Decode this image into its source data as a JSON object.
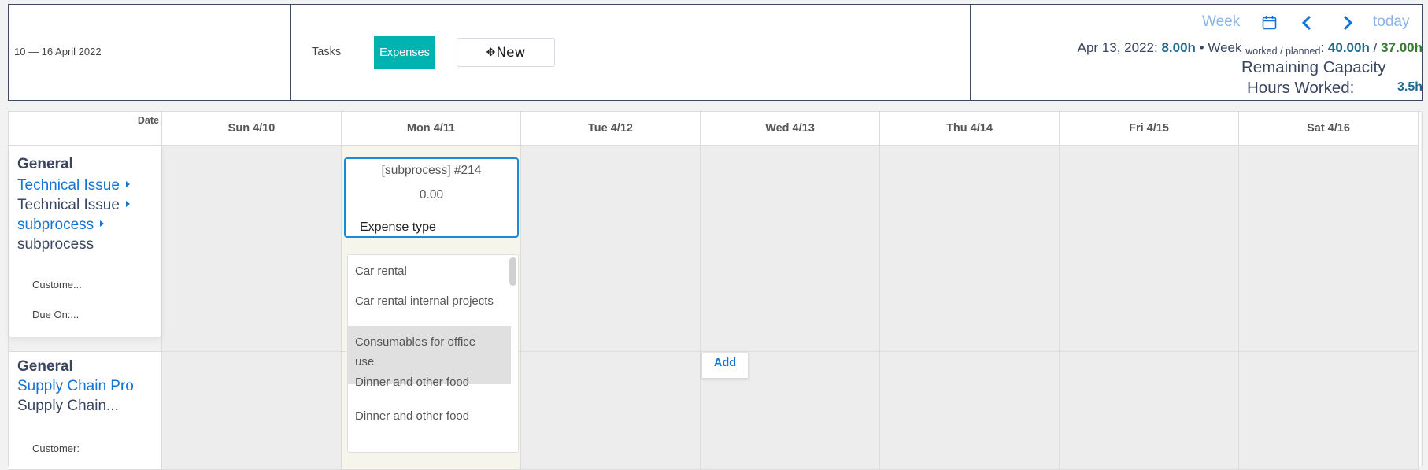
{
  "header": {
    "date_range": "10 — 16 April 2022",
    "tabs": [
      {
        "label": "Tasks",
        "active": false
      },
      {
        "label": "Expenses",
        "active": true
      }
    ],
    "new_button": {
      "icon": "move-icon",
      "label": "New"
    },
    "nav": {
      "view_label": "Week",
      "calendar_icon": "calendar-icon",
      "prev_icon": "chevron-left-icon",
      "next_icon": "chevron-right-icon",
      "today_label": "today"
    },
    "summary": {
      "date": "Apr 13, 2022:",
      "day_hours": "8.00h",
      "separator": "•",
      "week_label": "Week",
      "week_sub": "worked / planned",
      "colon": ":",
      "worked": "40.00h",
      "slash": "/",
      "planned": "37.00h"
    },
    "remaining_capacity_label": "Remaining Capacity",
    "hours_worked_label": "Hours Worked:",
    "hours_worked_value": "3.5h"
  },
  "grid": {
    "date_header": "Date",
    "days": [
      {
        "label": "Sun 4/10",
        "today": false
      },
      {
        "label": "Mon 4/11",
        "today": true
      },
      {
        "label": "Tue 4/12",
        "today": false
      },
      {
        "label": "Wed 4/13",
        "today": false
      },
      {
        "label": "Thu 4/14",
        "today": false
      },
      {
        "label": "Fri 4/15",
        "today": false
      },
      {
        "label": "Sat 4/16",
        "today": false
      }
    ],
    "rows": [
      {
        "title": "General",
        "link1": "Technical Issue",
        "text1": "Technical Issue",
        "link2": "subprocess",
        "text2": "subprocess",
        "customer": "Custome...",
        "due_on": "Due On:..."
      },
      {
        "title": "General",
        "link1": "Supply Chain Pro",
        "text1": "Supply Chain...",
        "customer": "Customer:"
      }
    ]
  },
  "expense_card": {
    "title": "[subprocess] #214",
    "amount": "0.00",
    "type_label": "Expense type"
  },
  "expense_type_options": [
    "Car rental",
    "Car rental internal projects",
    "Consumables for office use",
    "Dinner and other food",
    "Dinner and other food"
  ],
  "hovered_option_index": 2,
  "add_button": "Add",
  "colors": {
    "accent_teal": "#00b3b0",
    "link_blue": "#1474d4",
    "card_border": "#1a8ad8",
    "stat_blue": "#1e6a8f",
    "stat_green": "#3a7a33"
  }
}
